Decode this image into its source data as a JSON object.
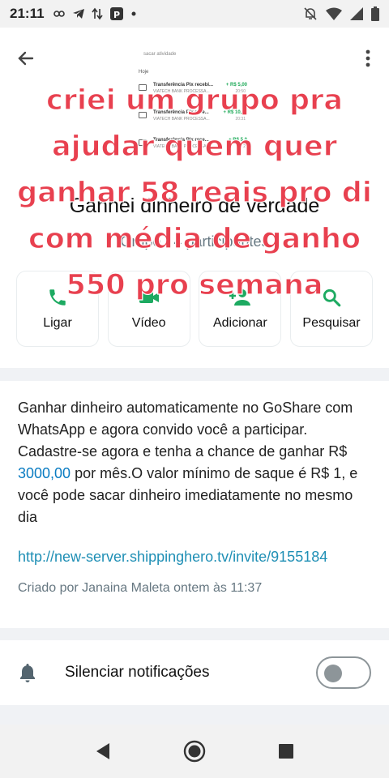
{
  "status_bar": {
    "time": "21:11",
    "icons": [
      "link-icon",
      "telegram-icon",
      "data-arrows-icon",
      "p-app-icon",
      "dot-icon",
      "mute-notification-icon",
      "wifi-icon",
      "signal-icon",
      "battery-icon"
    ]
  },
  "header": {
    "group_name": "Ganhei dinheiro de verdade",
    "group_meta": "Grupo · 4 participantes",
    "photo": {
      "search_text": "sacar atividade",
      "today_label": "Hoje",
      "transactions": [
        {
          "title": "Transferência Pix recebi...",
          "subtitle": "VIATECH BANK PROCESSA...",
          "amount": "+ R$ 5,00",
          "time": "20:50"
        },
        {
          "title": "Transferência Pix rece...",
          "subtitle": "VIATECH BANK PROCESSA...",
          "amount": "+ R$ 10,00",
          "time": "20:31"
        },
        {
          "title": "Transferência Pix rece...",
          "subtitle": "VIATECH BANK PROCESSA...",
          "amount": "+ R$ 5,0",
          "time": "2"
        }
      ]
    },
    "actions": [
      {
        "label": "Ligar",
        "icon": "phone-icon"
      },
      {
        "label": "Vídeo",
        "icon": "video-icon"
      },
      {
        "label": "Adicionar",
        "icon": "add-person-icon"
      },
      {
        "label": "Pesquisar",
        "icon": "search-icon"
      }
    ]
  },
  "overlay_caption": {
    "lines": [
      "criei um grupo pra",
      "ajudar quem quer",
      "ganhar 58 reais pro di",
      "com média de ganho",
      "550 pro semana"
    ],
    "color": "#e8404f"
  },
  "description": {
    "text_before": "Ganhar dinheiro automaticamente no GoShare com WhatsApp e agora convido você a participar. Cadastre-se agora e tenha a chance de ganhar R$ ",
    "amount": "3000,00",
    "text_after": " por mês.O valor mínimo de saque é R$ 1, e você pode sacar dinheiro imediatamente no mesmo dia",
    "link": "http://new-server.shippinghero.tv/invite/9155184",
    "created_by": "Criado por Janaina Maleta ontem às 11:37"
  },
  "mute": {
    "label": "Silenciar notificações",
    "enabled": false
  },
  "colors": {
    "accent": "#25d366",
    "link": "#1f8fb5",
    "muted_text": "#667781"
  }
}
